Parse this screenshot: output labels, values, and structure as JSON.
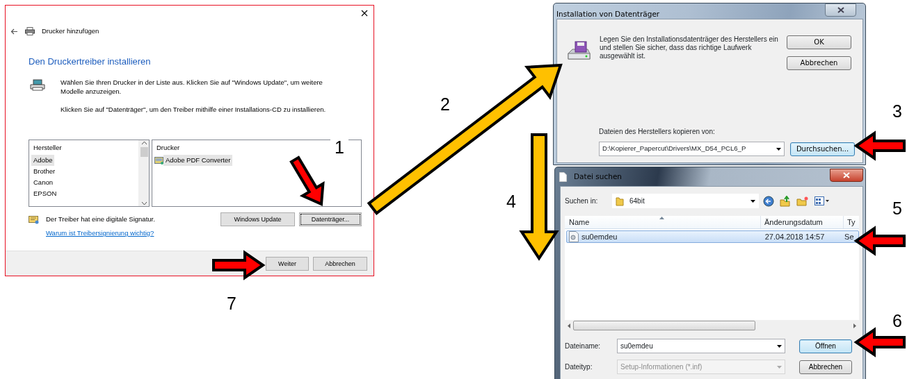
{
  "wizard": {
    "title": "Drucker hinzufügen",
    "heading": "Den Druckertreiber installieren",
    "paragraphs": [
      "Wählen Sie Ihren Drucker in der Liste aus. Klicken Sie auf \"Windows Update\", um weitere Modelle anzuzeigen.",
      "Klicken Sie auf \"Datenträger\", um den Treiber mithilfe einer Installations-CD zu installieren."
    ],
    "manufacturers": {
      "header": "Hersteller",
      "items": [
        {
          "label": "Adobe",
          "selected": true
        },
        {
          "label": "Brother",
          "selected": false
        },
        {
          "label": "Canon",
          "selected": false
        },
        {
          "label": "EPSON",
          "selected": false
        }
      ]
    },
    "printers": {
      "header": "Drucker",
      "items": [
        {
          "label": "Adobe PDF Converter",
          "selected": true
        }
      ]
    },
    "signature": "Der Treiber hat eine digitale Signatur.",
    "link": "Warum ist Treibersignierung wichtig?",
    "buttons": [
      {
        "label": "Windows Update",
        "focused": false
      },
      {
        "label": "Datenträger...",
        "focused": true
      }
    ],
    "footer_buttons": [
      "Weiter",
      "Abbrechen"
    ]
  },
  "disk_dialog": {
    "title": "Installation von Datenträger",
    "message": "Legen Sie den Installationsdatenträger des Herstellers ein und stellen Sie sicher, dass das richtige Laufwerk ausgewählt ist.",
    "buttons": [
      {
        "label": "OK",
        "default": false
      },
      {
        "label": "Abbrechen",
        "default": false
      }
    ],
    "path_label": "Dateien des Herstellers kopieren von:",
    "path_value": "D:\\Kopierer_Papercut\\Drivers\\MX_D54_PCL6_P",
    "browse_button": {
      "label": "Durchsuchen...",
      "default": true
    }
  },
  "file_dialog": {
    "title": "Datei suchen",
    "look_in_label": "Suchen in:",
    "look_in_value": "64bit",
    "columns": [
      "Name",
      "Änderungsdatum",
      "Ty"
    ],
    "rows": [
      {
        "cells": [
          "su0emdeu",
          "27.04.2018 14:57",
          "Se"
        ],
        "selected": true
      }
    ],
    "filename_label": "Dateiname:",
    "filename_value": "su0emdeu",
    "filetype_label": "Dateityp:",
    "filetype_value": "Setup-Informationen (*.inf)",
    "filetype_disabled": true,
    "buttons": [
      {
        "label": "Öffnen",
        "default": true
      },
      {
        "label": "Abbrechen",
        "default": false
      }
    ]
  },
  "step_numbers": [
    "1",
    "2",
    "3",
    "4",
    "5",
    "6",
    "7"
  ],
  "arrows": [
    {
      "color": "#ff0000"
    },
    {
      "color": "#ffc000"
    },
    {
      "color": "#ffc000"
    },
    {
      "color": "#ff0000"
    },
    {
      "color": "#ff0000"
    },
    {
      "color": "#ff0000"
    },
    {
      "color": "#ff0000"
    }
  ]
}
